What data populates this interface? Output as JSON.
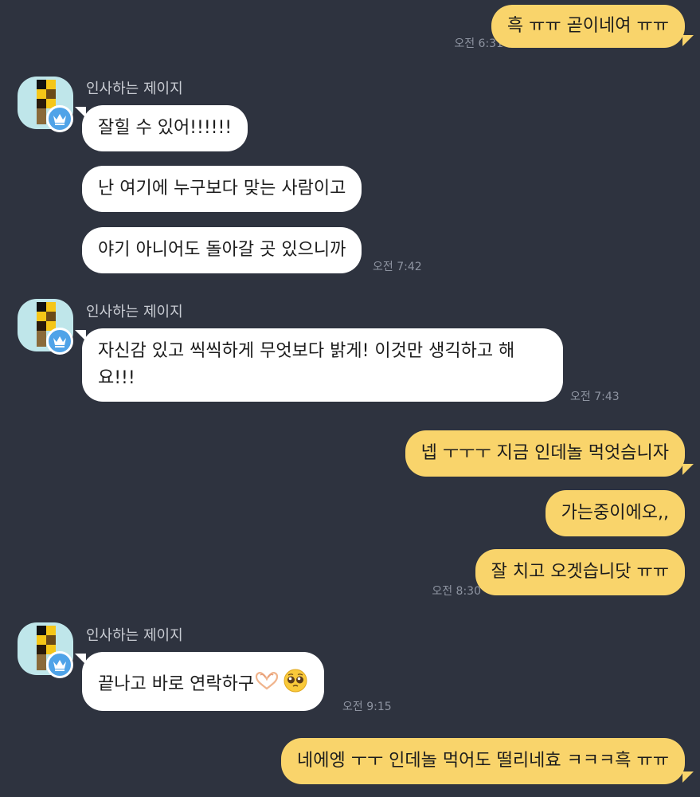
{
  "contact": {
    "name": "인사하는 제이지"
  },
  "messages": {
    "m1": {
      "text": "흑 ㅠㅠ 곧이네여 ㅠㅠ",
      "time": "오전 6:31"
    },
    "g1": {
      "name": "인사하는 제이지",
      "b1": "잘힐 수 있어!!!!!!",
      "b2": "난 여기에 누구보다 맞는 사람이고",
      "b3": "야기 아니어도 돌아갈 곳 있으니까",
      "time": "오전 7:42"
    },
    "g2": {
      "name": "인사하는 제이지",
      "b1": "자신감 있고 씩씩하게 무엇보다 밝게! 이것만 생긱하고 해요!!!",
      "time": "오전 7:43"
    },
    "m2": {
      "b1": "넵 ㅜㅜㅜ 지금 인데놀 먹엇슴니자",
      "b2": "가는중이에오,,",
      "b3": "잘 치고 오겟습니닷 ㅠㅠ",
      "time": "오전 8:30"
    },
    "g3": {
      "name": "인사하는 제이지",
      "b1": "끝나고 바로 연락하구",
      "time": "오전 9:15"
    },
    "m3": {
      "b1": "네에엥 ㅜㅜ 인데놀 먹어도 떨리네효 ㅋㅋㅋ흑 ㅠㅠ"
    }
  },
  "icons": {
    "avatar": "pixel-art-avatar",
    "badge": "crown-icon",
    "emoji1": "heart-hands-emoji",
    "emoji2": "pleading-face-emoji"
  },
  "colors": {
    "background": "#2e333f",
    "my_bubble": "#f9d46b",
    "their_bubble": "#ffffff",
    "badge": "#4fa3e8"
  }
}
